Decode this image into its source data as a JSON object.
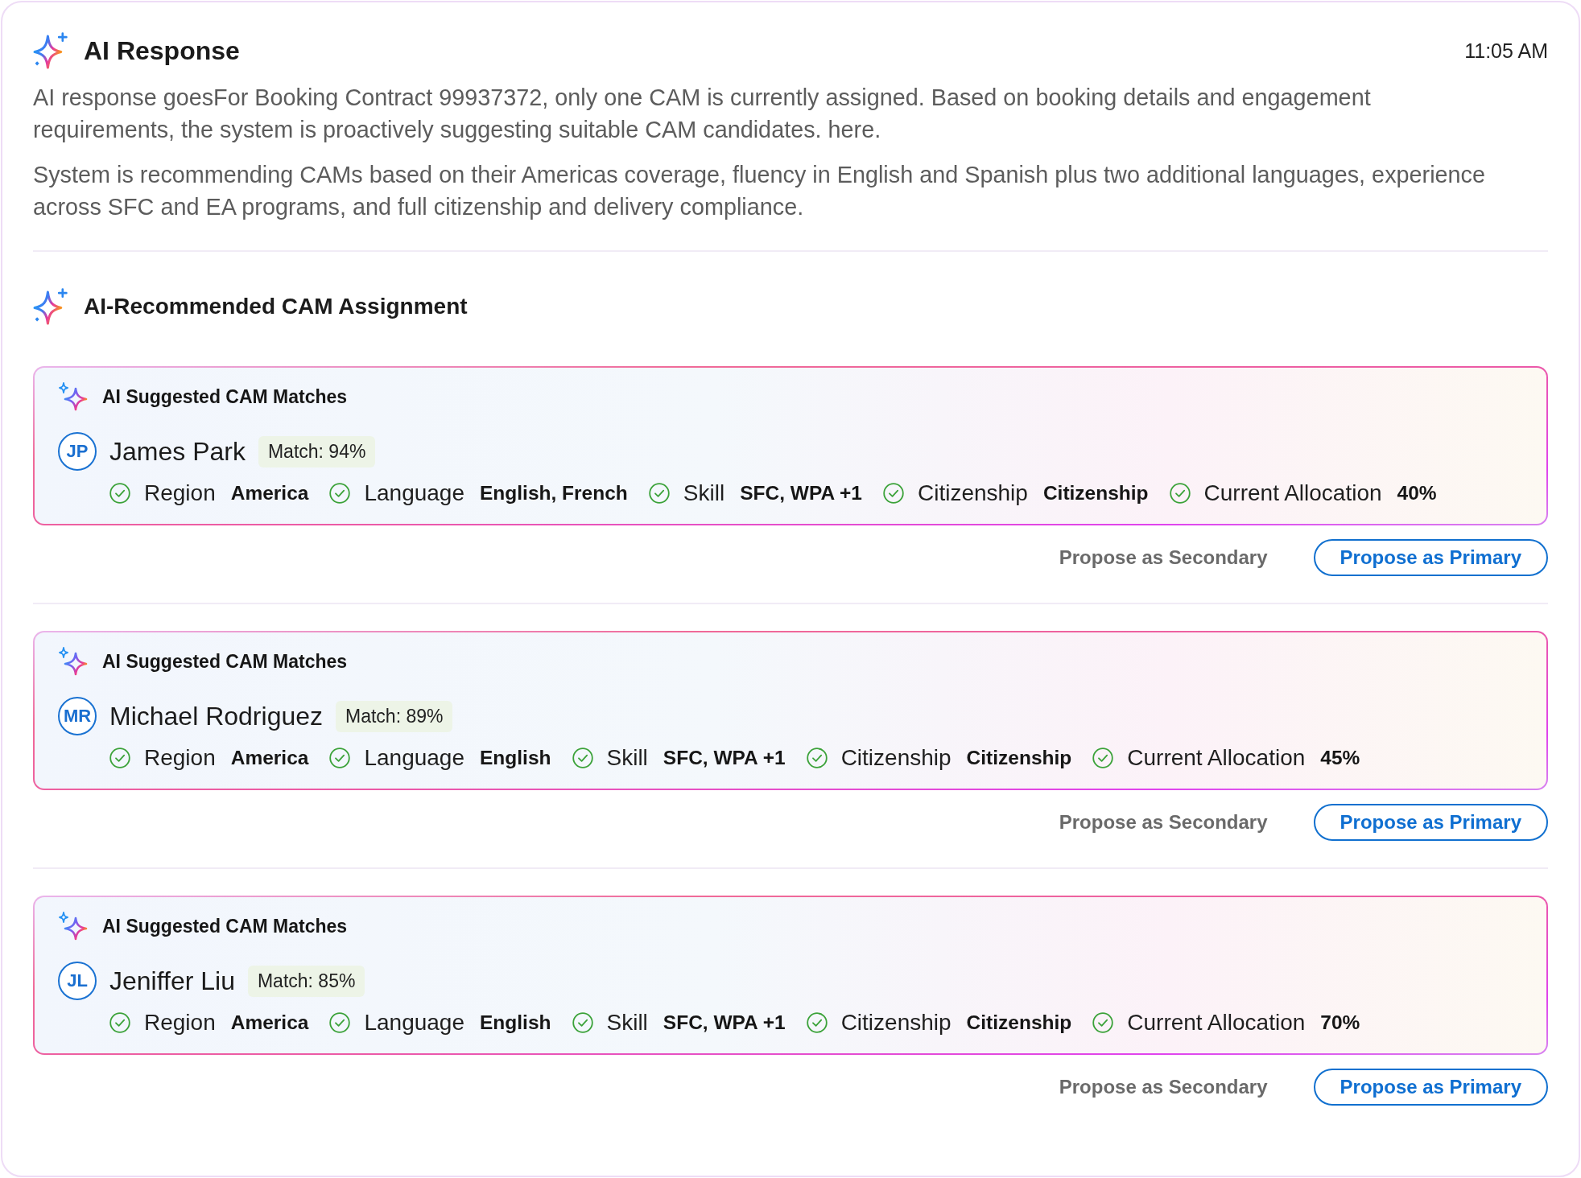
{
  "header": {
    "title": "AI Response",
    "time": "11:05 AM"
  },
  "paragraphs": [
    "AI response goesFor Booking Contract 99937372, only one CAM is currently assigned. Based on booking details and engagement requirements, the system is proactively suggesting suitable CAM candidates. here.",
    "System is recommending CAMs based on their Americas coverage, fluency in English and Spanish plus two additional languages, experience across SFC and EA programs, and full citizenship and delivery compliance."
  ],
  "section": {
    "title": "AI-Recommended CAM Assignment"
  },
  "candidates": [
    {
      "card_title": "AI Suggested CAM Matches",
      "initials": "JP",
      "name": "James Park",
      "match": "Match: 94%",
      "criteria": [
        {
          "label": "Region",
          "value": "America",
          "met": true
        },
        {
          "label": "Language",
          "value": "English, French",
          "met": true
        },
        {
          "label": "Skill",
          "value": "SFC, WPA +1",
          "met": true
        },
        {
          "label": "Citizenship",
          "value": "Citizenship",
          "met": true
        },
        {
          "label": "Current Allocation",
          "value": "40%",
          "met": true
        }
      ],
      "actions": [
        {
          "kind": "secondary",
          "label": "Propose as Secondary"
        },
        {
          "kind": "primary",
          "label": "Propose as Primary"
        }
      ]
    },
    {
      "card_title": "AI Suggested CAM Matches",
      "initials": "MR",
      "name": "Michael Rodriguez",
      "match": "Match: 89%",
      "criteria": [
        {
          "label": "Region",
          "value": "America",
          "met": true
        },
        {
          "label": "Language",
          "value": "English",
          "met": true
        },
        {
          "label": "Skill",
          "value": "SFC, WPA +1",
          "met": true
        },
        {
          "label": "Citizenship",
          "value": "Citizenship",
          "met": true
        },
        {
          "label": "Current Allocation",
          "value": "45%",
          "met": true
        }
      ],
      "actions": [
        {
          "kind": "secondary",
          "label": "Propose as Secondary"
        },
        {
          "kind": "primary",
          "label": "Propose as Primary"
        }
      ]
    },
    {
      "card_title": "AI Suggested CAM Matches",
      "initials": "JL",
      "name": "Jeniffer Liu",
      "match": "Match: 85%",
      "criteria": [
        {
          "label": "Region",
          "value": "America",
          "met": true
        },
        {
          "label": "Language",
          "value": "English",
          "met": true
        },
        {
          "label": "Skill",
          "value": "SFC, WPA +1",
          "met": true
        },
        {
          "label": "Citizenship",
          "value": "Citizenship",
          "met": true
        },
        {
          "label": "Current Allocation",
          "value": "70%",
          "met": true
        }
      ],
      "actions": [
        {
          "kind": "secondary",
          "label": "Propose as Secondary"
        },
        {
          "kind": "primary",
          "label": "Propose as Primary"
        }
      ]
    }
  ]
}
